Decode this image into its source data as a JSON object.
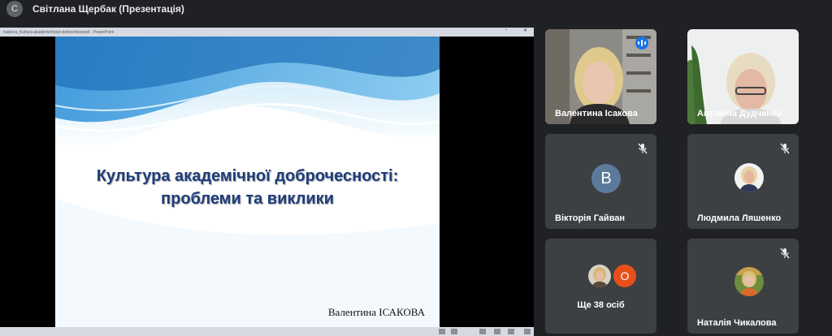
{
  "header": {
    "badge": "С",
    "title": "Світлана Щербак (Презентація)"
  },
  "presentation": {
    "window_title": "Isakova_Kultura-akademichnoyi-dobrochesnosti - PowerPoint",
    "app_label": "PowerPoint",
    "slide": {
      "title_line1": "Культура академічної доброчесності:",
      "title_line2": "проблеми та виклики",
      "author": "Валентина ІСАКОВА"
    }
  },
  "participants": [
    {
      "name": "Валентина Ісакова",
      "muted": false,
      "speaking": true
    },
    {
      "name": "Антоніна Дудченко",
      "muted": false,
      "speaking": false
    },
    {
      "name": "Вікторія Гайван",
      "avatar_letter": "В",
      "muted": true
    },
    {
      "name": "Людмила Ляшенко",
      "muted": true
    },
    {
      "name": "Наталія Чикалова",
      "muted": true
    }
  ],
  "more": {
    "label": "Ще 38 осіб",
    "avatar_letter": "О"
  },
  "colors": {
    "background": "#202124",
    "tile": "#3c4043",
    "accent": "#1a73e8",
    "slide_title": "#1f3d7a"
  }
}
